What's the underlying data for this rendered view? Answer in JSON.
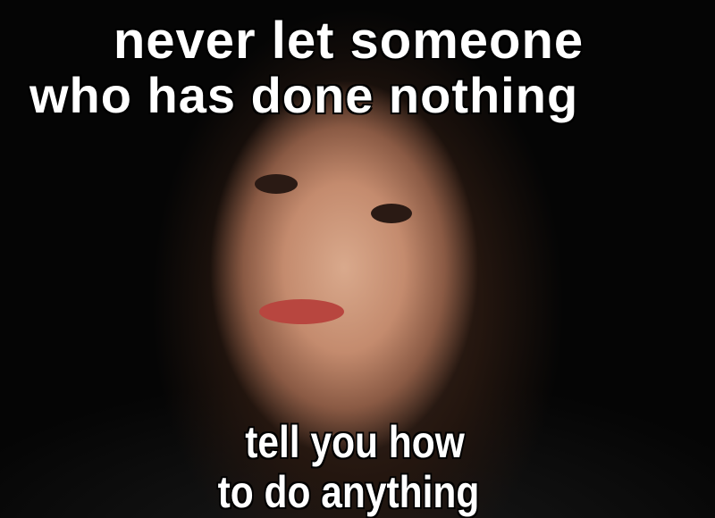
{
  "meme": {
    "top_text": [
      "never let someone",
      "who has done nothing"
    ],
    "bottom_text": [
      "tell you how",
      "to do anything"
    ]
  }
}
